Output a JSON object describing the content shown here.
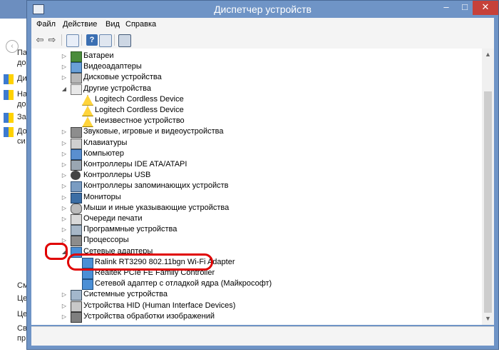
{
  "background_window": {
    "left_texts": [
      "Па",
      "до",
      "Ди",
      "На",
      "до",
      "За",
      "До",
      "си",
      "См",
      "Це",
      "Це",
      "Св",
      "пр"
    ]
  },
  "window": {
    "title": "Диспетчер устройств",
    "controls": {
      "minimize": "–",
      "maximize": "□",
      "close": "✕"
    },
    "menu": [
      "Файл",
      "Действие",
      "Вид",
      "Справка"
    ],
    "toolbar": [
      "back-arrow-icon",
      "forward-arrow-icon",
      "properties-icon",
      "help-icon",
      "scan-hardware-icon"
    ]
  },
  "tree": [
    {
      "label": "Батареи",
      "state": "collapsed",
      "level": 0,
      "icon": "battery-icon"
    },
    {
      "label": "Видеоадаптеры",
      "state": "collapsed",
      "level": 0,
      "icon": "display-adapter-icon"
    },
    {
      "label": "Дисковые устройства",
      "state": "collapsed",
      "level": 0,
      "icon": "disk-drive-icon"
    },
    {
      "label": "Другие устройства",
      "state": "expanded",
      "level": 0,
      "icon": "other-devices-icon"
    },
    {
      "label": "Logitech Cordless Device",
      "state": "leaf",
      "level": 1,
      "icon": "warning-icon"
    },
    {
      "label": "Logitech Cordless Device",
      "state": "leaf",
      "level": 1,
      "icon": "warning-icon"
    },
    {
      "label": "Неизвестное устройство",
      "state": "leaf",
      "level": 1,
      "icon": "warning-icon"
    },
    {
      "label": "Звуковые, игровые и видеоустройства",
      "state": "collapsed",
      "level": 0,
      "icon": "sound-icon"
    },
    {
      "label": "Клавиатуры",
      "state": "collapsed",
      "level": 0,
      "icon": "keyboard-icon"
    },
    {
      "label": "Компьютер",
      "state": "collapsed",
      "level": 0,
      "icon": "computer-icon"
    },
    {
      "label": "Контроллеры IDE ATA/ATAPI",
      "state": "collapsed",
      "level": 0,
      "icon": "ide-controller-icon"
    },
    {
      "label": "Контроллеры USB",
      "state": "collapsed",
      "level": 0,
      "icon": "usb-icon"
    },
    {
      "label": "Контроллеры запоминающих устройств",
      "state": "collapsed",
      "level": 0,
      "icon": "storage-controller-icon"
    },
    {
      "label": "Мониторы",
      "state": "collapsed",
      "level": 0,
      "icon": "monitor-icon"
    },
    {
      "label": "Мыши и иные указывающие устройства",
      "state": "collapsed",
      "level": 0,
      "icon": "mouse-icon"
    },
    {
      "label": "Очереди печати",
      "state": "collapsed",
      "level": 0,
      "icon": "print-queue-icon"
    },
    {
      "label": "Программные устройства",
      "state": "collapsed",
      "level": 0,
      "icon": "software-device-icon"
    },
    {
      "label": "Процессоры",
      "state": "collapsed",
      "level": 0,
      "icon": "processor-icon"
    },
    {
      "label": "Сетевые адаптеры",
      "state": "expanded",
      "level": 0,
      "icon": "network-adapter-icon"
    },
    {
      "label": "Ralink RT3290 802.11bgn Wi-Fi Adapter",
      "state": "leaf",
      "level": 1,
      "icon": "network-adapter-icon"
    },
    {
      "label": "Realtek PCIe FE Family Controller",
      "state": "leaf",
      "level": 1,
      "icon": "network-adapter-icon"
    },
    {
      "label": "Сетевой адаптер с отладкой ядра (Майкрософт)",
      "state": "leaf",
      "level": 1,
      "icon": "network-adapter-icon"
    },
    {
      "label": "Системные устройства",
      "state": "collapsed",
      "level": 0,
      "icon": "system-device-icon"
    },
    {
      "label": "Устройства HID (Human Interface Devices)",
      "state": "collapsed",
      "level": 0,
      "icon": "hid-icon"
    },
    {
      "label": "Устройства обработки изображений",
      "state": "collapsed",
      "level": 0,
      "icon": "imaging-device-icon"
    }
  ],
  "colors": {
    "title_bar": "#6f94c6",
    "close_button": "#c6413a",
    "annotation": "#e00000"
  }
}
